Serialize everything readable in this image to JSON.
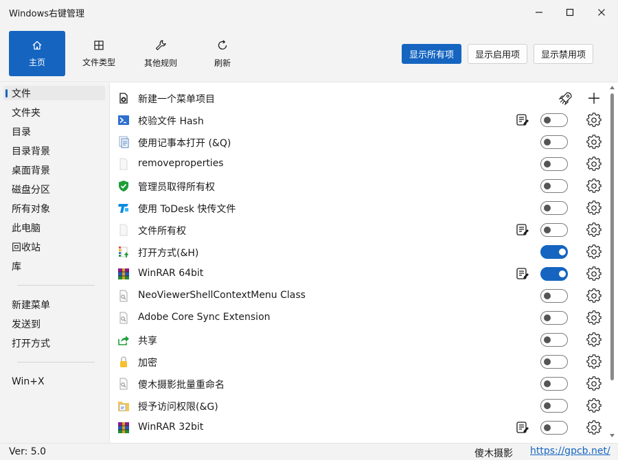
{
  "window": {
    "title": "Windows右键管理",
    "minimize_icon": "minimize-icon",
    "maximize_icon": "maximize-icon",
    "close_icon": "close-icon"
  },
  "toolbar": {
    "buttons": [
      {
        "label": "主页",
        "icon": "home-icon",
        "active": true
      },
      {
        "label": "文件类型",
        "icon": "grid-icon",
        "active": false
      },
      {
        "label": "其他规则",
        "icon": "wrench-icon",
        "active": false
      },
      {
        "label": "刷新",
        "icon": "refresh-icon",
        "active": false
      }
    ],
    "filters": [
      {
        "label": "显示所有项",
        "active": true
      },
      {
        "label": "显示启用项",
        "active": false
      },
      {
        "label": "显示禁用项",
        "active": false
      }
    ]
  },
  "sidebar": {
    "items": [
      "文件",
      "文件夹",
      "目录",
      "目录背景",
      "桌面背景",
      "磁盘分区",
      "所有对象",
      "此电脑",
      "回收站",
      "库"
    ],
    "items2": [
      "新建菜单",
      "发送到",
      "打开方式"
    ],
    "items3": [
      "Win+X"
    ],
    "selected": "文件"
  },
  "content": {
    "new_item": {
      "label": "新建一个菜单项目",
      "icon": "new-item-icon",
      "rocket_icon": "rocket-icon",
      "add_icon": "plus-icon"
    },
    "items": [
      {
        "label": "校验文件 Hash",
        "icon": "powershell-icon",
        "registry": true,
        "enabled": false
      },
      {
        "label": "使用记事本打开 (&Q)",
        "icon": "notepad-icon",
        "registry": false,
        "enabled": false
      },
      {
        "label": "removeproperties",
        "icon": "blank-file-icon",
        "registry": false,
        "enabled": false
      },
      {
        "label": "管理员取得所有权",
        "icon": "shield-icon",
        "registry": false,
        "enabled": false
      },
      {
        "label": "使用 ToDesk 快传文件",
        "icon": "todesk-icon",
        "registry": false,
        "enabled": false
      },
      {
        "label": "文件所有权",
        "icon": "blank-file-icon",
        "registry": true,
        "enabled": false
      },
      {
        "label": "打开方式(&H)",
        "icon": "open-with-icon",
        "registry": false,
        "enabled": true
      },
      {
        "label": "WinRAR 64bit",
        "icon": "winrar-icon",
        "registry": true,
        "enabled": true
      },
      {
        "label": "NeoViewerShellContextMenu Class",
        "icon": "dll-file-icon",
        "registry": false,
        "enabled": false
      },
      {
        "label": "Adobe Core Sync Extension",
        "icon": "dll-file-icon",
        "registry": false,
        "enabled": false
      },
      {
        "label": "共享",
        "icon": "share-icon",
        "registry": false,
        "enabled": false
      },
      {
        "label": "加密",
        "icon": "lock-icon",
        "registry": false,
        "enabled": false
      },
      {
        "label": "傻木摄影批量重命名",
        "icon": "dll-file-icon",
        "registry": false,
        "enabled": false
      },
      {
        "label": "授予访问权限(&G)",
        "icon": "folder-access-icon",
        "registry": false,
        "enabled": false
      },
      {
        "label": "WinRAR 32bit",
        "icon": "winrar-icon",
        "registry": true,
        "enabled": false
      }
    ]
  },
  "status": {
    "version": "Ver: 5.0",
    "author": "傻木摄影",
    "website": "https://gpcb.net/"
  },
  "colors": {
    "accent": "#1565c0",
    "background": "#f3f3f3"
  }
}
